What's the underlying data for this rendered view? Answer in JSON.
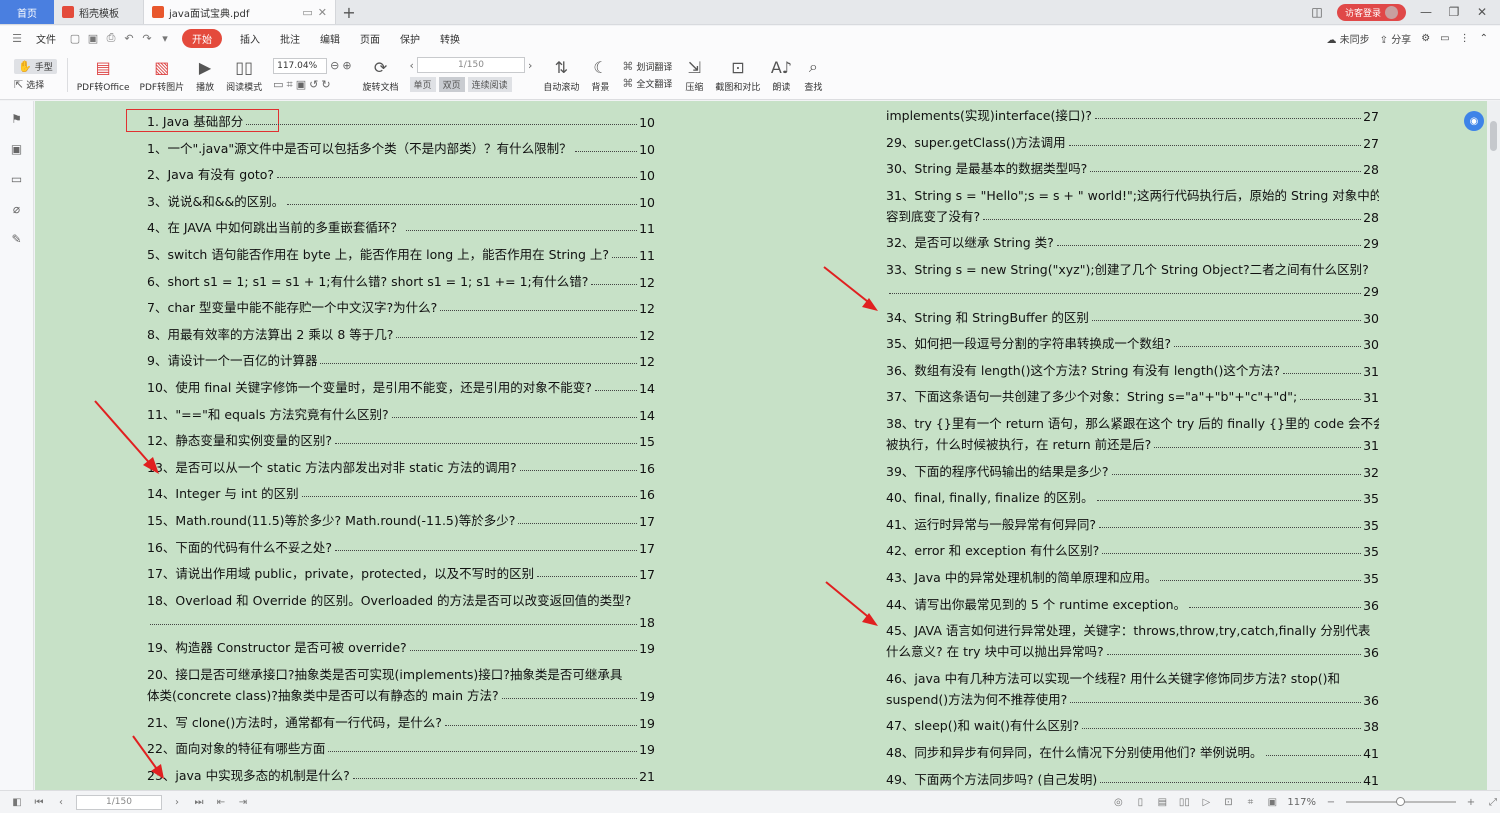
{
  "tabs": {
    "home": "首页",
    "template": "稻壳模板",
    "document": "java面试宝典.pdf"
  },
  "login_label": "访客登录",
  "menu": {
    "file": "文件",
    "items": [
      "开始",
      "插入",
      "批注",
      "编辑",
      "页面",
      "保护",
      "转换"
    ],
    "right": {
      "sync": "未同步",
      "share": "分享"
    }
  },
  "ribbon": {
    "hand": "手型",
    "select": "选择",
    "pdf_to_office": "PDF转Office",
    "pdf_to_image": "PDF转图片",
    "play": "播放",
    "read_mode": "阅读模式",
    "zoom": "117.04%",
    "page": "1/150",
    "rotate": "旋转文档",
    "single": "单页",
    "double": "双页",
    "continuous": "连续阅读",
    "auto_scroll": "自动滚动",
    "background": "背景",
    "word_translate": "划词翻译",
    "full_translate": "全文翻译",
    "compress": "压缩",
    "screenshot_compare": "截图和对比",
    "read_aloud": "朗读",
    "find": "查找"
  },
  "toc_left": [
    {
      "lines": [
        "1. Java 基础部分"
      ],
      "page": "10",
      "title": true
    },
    {
      "lines": [
        "1、一个\".java\"源文件中是否可以包括多个类（不是内部类）？有什么限制？"
      ],
      "page": "10"
    },
    {
      "lines": [
        "2、Java 有没有 goto?"
      ],
      "page": "10"
    },
    {
      "lines": [
        "3、说说&和&&的区别。"
      ],
      "page": "10"
    },
    {
      "lines": [
        "4、在 JAVA 中如何跳出当前的多重嵌套循环？"
      ],
      "page": "11"
    },
    {
      "lines": [
        "5、switch 语句能否作用在 byte 上，能否作用在 long 上，能否作用在 String 上?"
      ],
      "page": "11"
    },
    {
      "lines": [
        "6、short s1 = 1; s1 = s1 + 1;有什么错? short s1 = 1; s1 += 1;有什么错?"
      ],
      "page": "12"
    },
    {
      "lines": [
        "7、char 型变量中能不能存贮一个中文汉字?为什么?"
      ],
      "page": "12"
    },
    {
      "lines": [
        "8、用最有效率的方法算出 2 乘以 8 等于几?"
      ],
      "page": "12"
    },
    {
      "lines": [
        "9、请设计一个一百亿的计算器"
      ],
      "page": "12"
    },
    {
      "lines": [
        "10、使用 final 关键字修饰一个变量时，是引用不能变，还是引用的对象不能变?"
      ],
      "page": "14"
    },
    {
      "lines": [
        "11、\"==\"和 equals 方法究竟有什么区别?"
      ],
      "page": "14"
    },
    {
      "lines": [
        "12、静态变量和实例变量的区别?"
      ],
      "page": "15"
    },
    {
      "lines": [
        "13、是否可以从一个 static 方法内部发出对非 static 方法的调用?"
      ],
      "page": "16"
    },
    {
      "lines": [
        "14、Integer 与 int 的区别"
      ],
      "page": "16"
    },
    {
      "lines": [
        "15、Math.round(11.5)等於多少? Math.round(-11.5)等於多少?"
      ],
      "page": "17"
    },
    {
      "lines": [
        "16、下面的代码有什么不妥之处?"
      ],
      "page": "17"
    },
    {
      "lines": [
        "17、请说出作用域 public，private，protected，以及不写时的区别"
      ],
      "page": "17"
    },
    {
      "lines": [
        "18、Overload 和 Override 的区别。Overloaded 的方法是否可以改变返回值的类型?",
        ""
      ],
      "page": "18"
    },
    {
      "lines": [
        "19、构造器 Constructor 是否可被 override?"
      ],
      "page": "19"
    },
    {
      "lines": [
        "20、接口是否可继承接口?抽象类是否可实现(implements)接口?抽象类是否可继承具",
        "体类(concrete class)?抽象类中是否可以有静态的 main 方法?"
      ],
      "page": "19"
    },
    {
      "lines": [
        "21、写 clone()方法时，通常都有一行代码，是什么?"
      ],
      "page": "19"
    },
    {
      "lines": [
        "22、面向对象的特征有哪些方面"
      ],
      "page": "19"
    },
    {
      "lines": [
        "23、java 中实现多态的机制是什么?"
      ],
      "page": "21"
    }
  ],
  "toc_right": [
    {
      "lines": [
        "implements(实现)interface(接口)?"
      ],
      "page": "27"
    },
    {
      "lines": [
        "29、super.getClass()方法调用"
      ],
      "page": "27"
    },
    {
      "lines": [
        "30、String 是最基本的数据类型吗?"
      ],
      "page": "28"
    },
    {
      "lines": [
        "31、String s = \"Hello\";s = s + \" world!\";这两行代码执行后，原始的 String 对象中的内",
        "容到底变了没有?"
      ],
      "page": "28"
    },
    {
      "lines": [
        "32、是否可以继承 String 类?"
      ],
      "page": "29"
    },
    {
      "lines": [
        "33、String s = new String(\"xyz\");创建了几个 String Object?二者之间有什么区别?",
        ""
      ],
      "page": "29"
    },
    {
      "lines": [
        "34、String 和 StringBuffer 的区别"
      ],
      "page": "30"
    },
    {
      "lines": [
        "35、如何把一段逗号分割的字符串转换成一个数组?"
      ],
      "page": "30"
    },
    {
      "lines": [
        "36、数组有没有 length()这个方法? String 有没有 length()这个方法?"
      ],
      "page": "31"
    },
    {
      "lines": [
        "37、下面这条语句一共创建了多少个对象：String s=\"a\"+\"b\"+\"c\"+\"d\";"
      ],
      "page": "31"
    },
    {
      "lines": [
        "38、try {}里有一个 return 语句，那么紧跟在这个 try 后的 finally {}里的 code 会不会",
        "被执行，什么时候被执行，在 return 前还是后?"
      ],
      "page": "31"
    },
    {
      "lines": [
        "39、下面的程序代码输出的结果是多少?"
      ],
      "page": "32"
    },
    {
      "lines": [
        "40、final, finally, finalize 的区别。"
      ],
      "page": "35"
    },
    {
      "lines": [
        "41、运行时异常与一般异常有何异同?"
      ],
      "page": "35"
    },
    {
      "lines": [
        "42、error 和 exception 有什么区别?"
      ],
      "page": "35"
    },
    {
      "lines": [
        "43、Java 中的异常处理机制的简单原理和应用。"
      ],
      "page": "35"
    },
    {
      "lines": [
        "44、请写出你最常见到的 5 个 runtime exception。"
      ],
      "page": "36"
    },
    {
      "lines": [
        "45、JAVA 语言如何进行异常处理，关键字：throws,throw,try,catch,finally 分别代表",
        "什么意义? 在 try 块中可以抛出异常吗?"
      ],
      "page": "36"
    },
    {
      "lines": [
        "46、java 中有几种方法可以实现一个线程? 用什么关键字修饰同步方法? stop()和",
        "suspend()方法为何不推荐使用?"
      ],
      "page": "36"
    },
    {
      "lines": [
        "47、sleep()和 wait()有什么区别?"
      ],
      "page": "38"
    },
    {
      "lines": [
        "48、同步和异步有何异同，在什么情况下分别使用他们? 举例说明。"
      ],
      "page": "41"
    },
    {
      "lines": [
        "49、下面两个方法同步吗? (自己发明)"
      ],
      "page": "41"
    }
  ],
  "statusbar": {
    "page": "1/150",
    "zoom": "117%"
  },
  "colors": {
    "page_bg": "#c7e1c7",
    "accent": "#e44a3c",
    "arrow": "#e02020",
    "home_tab": "#4a7fe0"
  }
}
